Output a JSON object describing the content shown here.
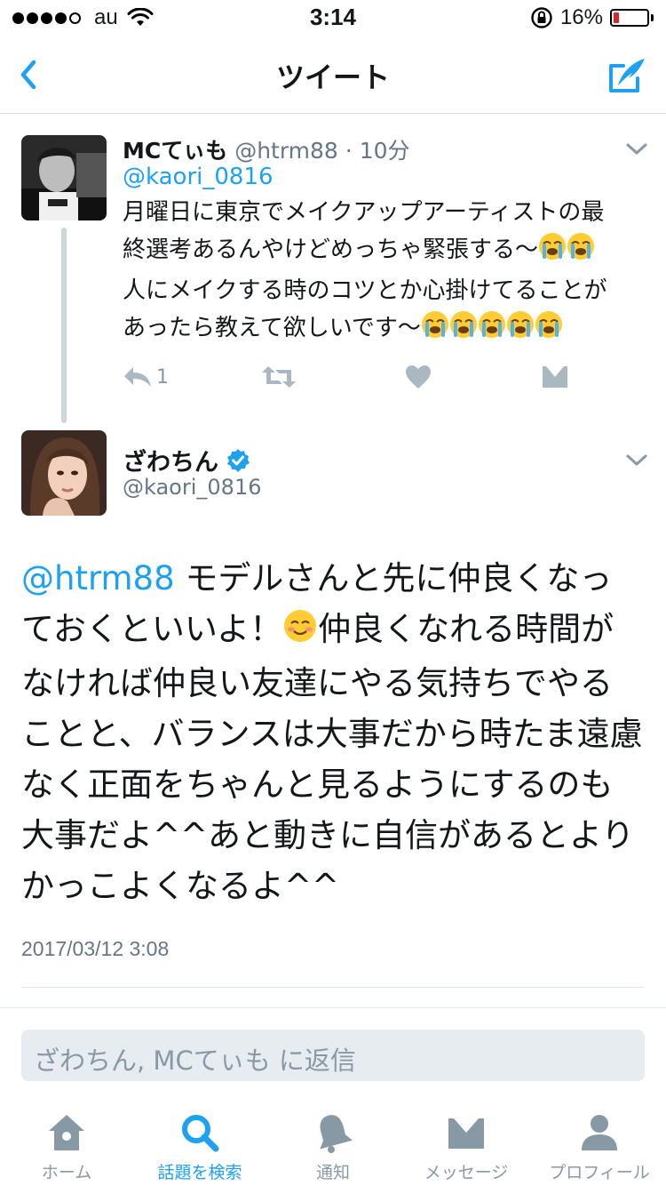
{
  "status_bar": {
    "carrier": "au",
    "time": "3:14",
    "battery": "16%",
    "battery_level": 0.16
  },
  "nav": {
    "title": "ツイート"
  },
  "tweet1": {
    "name": "MCてぃも",
    "handle": "@htrm88",
    "separator": " · ",
    "time_ago": "10分",
    "mention": "@kaori_0816",
    "text_lines": [
      "月曜日に東京でメイクアップアーティストの最",
      "終選考あるんやけどめっちゃ緊張する〜",
      "人にメイクする時のコツとか心掛けてることが",
      "あったら教えて欲しいです〜"
    ],
    "reply_count": "1"
  },
  "tweet2": {
    "name": "ざわちん",
    "handle": "@kaori_0816",
    "mention": "@htrm88",
    "text_part1": " モデルさんと先に仲良くなっておくといいよ！",
    "text_part2": "仲良くなれる時間がなければ仲良い友達にやる気持ちでやることと、バランスは大事だから時たま遠慮なく正面をちゃんと見るようにするのも大事だよ^^あと動きに自信があるとよりかっこよくなるよ^^",
    "date": "2017/03/12 3:08"
  },
  "reply": {
    "placeholder": "ざわちん, MCてぃも に返信"
  },
  "tabbar": {
    "items": [
      {
        "label": "ホーム",
        "icon": "home-icon"
      },
      {
        "label": "話題を検索",
        "icon": "search-icon"
      },
      {
        "label": "通知",
        "icon": "bell-icon"
      },
      {
        "label": "メッセージ",
        "icon": "envelope-icon"
      },
      {
        "label": "プロフィール",
        "icon": "person-icon"
      }
    ]
  },
  "colors": {
    "accent": "#1da1f2",
    "muted": "#8899a6",
    "battery_low": "#e0242a"
  }
}
